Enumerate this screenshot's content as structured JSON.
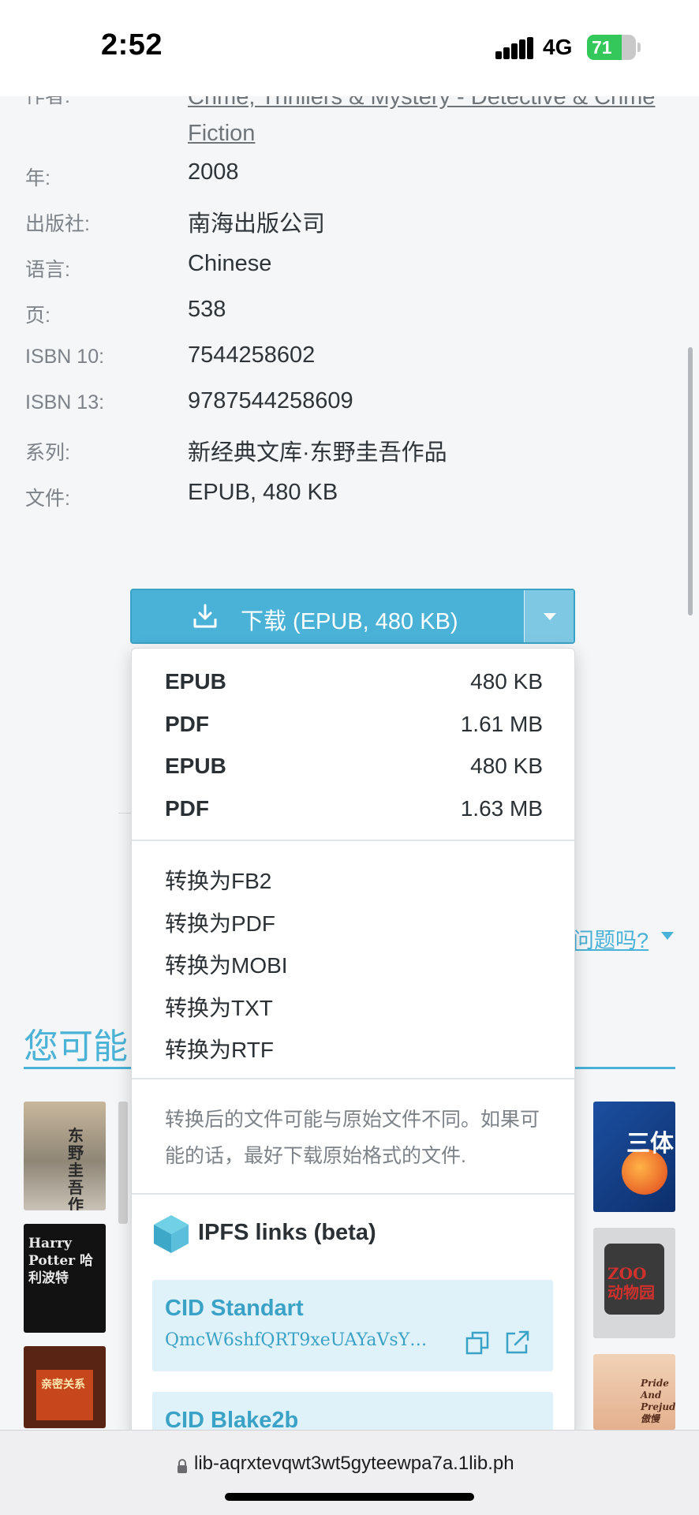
{
  "status_bar": {
    "time": "2:52",
    "network": "4G",
    "battery": "71",
    "battery_level": 0.71
  },
  "details": {
    "category_label": "作者:",
    "category_link": "Crime, Thrillers & Mystery - Detective & Crime Fiction",
    "rows": [
      {
        "label": "年:",
        "value": "2008"
      },
      {
        "label": "出版社:",
        "value": "南海出版公司"
      },
      {
        "label": "语言:",
        "value": "Chinese"
      },
      {
        "label": "页:",
        "value": "538"
      },
      {
        "label": "ISBN 10:",
        "value": "7544258602"
      },
      {
        "label": "ISBN 13:",
        "value": "9787544258609"
      },
      {
        "label": "系列:",
        "value": "新经典文库·东野圭吾作品"
      },
      {
        "label": "文件:",
        "value": "EPUB, 480 KB"
      }
    ]
  },
  "download": {
    "label": "下载 (EPUB, 480 KB)"
  },
  "dropdown": {
    "formats": [
      {
        "name": "EPUB",
        "size": "480 KB"
      },
      {
        "name": "PDF",
        "size": "1.61 MB"
      },
      {
        "name": "EPUB",
        "size": "480 KB"
      },
      {
        "name": "PDF",
        "size": "1.63 MB"
      }
    ],
    "conversions": [
      "转换为FB2",
      "转换为PDF",
      "转换为MOBI",
      "转换为TXT",
      "转换为RTF"
    ],
    "conversion_note": "转换后的文件可能与原始文件不同。如果可能的话，最好下载原始格式的文件.",
    "ipfs_title": "IPFS links (beta)",
    "cids": [
      {
        "title": "CID Standart",
        "hash": "QmcW6shfQRT9xeUAYaVsYR…"
      },
      {
        "title": "CID Blake2b",
        "hash": ""
      }
    ]
  },
  "background": {
    "problem_link": "问题吗?",
    "section_title": "您可能",
    "covers": [
      {
        "text": "东野圭吾作品"
      },
      {
        "text": "三体"
      },
      {
        "text": "Harry Potter 哈利波特"
      },
      {
        "text": "ZOO 动物园"
      },
      {
        "text": "亲密关系"
      },
      {
        "text": "Pride And Prejudice 傲慢"
      }
    ]
  },
  "browser": {
    "url": "lib-aqrxtevqwt3wt5gyteewpa7a.1lib.ph"
  },
  "colors": {
    "accent": "#49b2d6",
    "accent_light": "#dff1f9",
    "battery": "#34c759"
  }
}
